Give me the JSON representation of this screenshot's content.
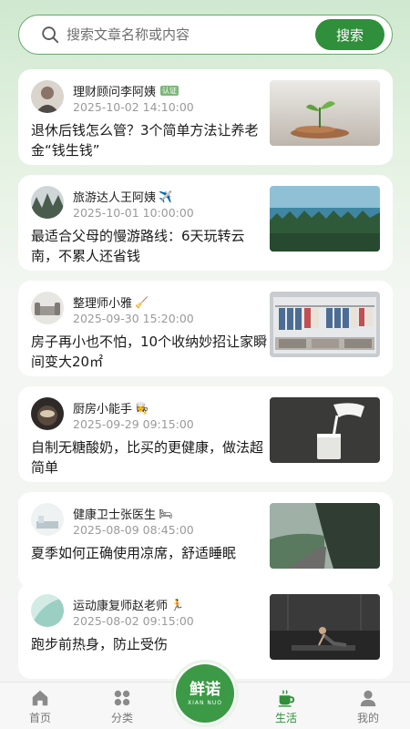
{
  "search": {
    "placeholder": "搜索文章名称或内容",
    "button_label": "搜索"
  },
  "articles": [
    {
      "author": "理财顾问李阿姨",
      "author_badge": "认证",
      "time": "2025-10-02 14:10:00",
      "title": "退休后钱怎么管？3个简单方法让养老金“钱生钱”"
    },
    {
      "author": "旅游达人王阿姨",
      "author_badge": "✈️",
      "time": "2025-10-01 10:00:00",
      "title": "最适合父母的慢游路线：6天玩转云南，不累人还省钱"
    },
    {
      "author": "整理师小雅",
      "author_badge": "🧹",
      "time": "2025-09-30 15:20:00",
      "title": "房子再小也不怕，10个收纳妙招让家瞬间变大20㎡"
    },
    {
      "author": "厨房小能手",
      "author_badge": "👩‍🍳",
      "time": "2025-09-29 09:15:00",
      "title": "自制无糖酸奶，比买的更健康，做法超简单"
    },
    {
      "author": "健康卫士张医生",
      "author_badge": "🛏",
      "time": "2025-08-09 08:45:00",
      "title": "夏季如何正确使用凉席，舒适睡眠"
    },
    {
      "author": "运动康复师赵老师",
      "author_badge": "🏃",
      "time": "2025-08-02 09:15:00",
      "title": "跑步前热身，防止受伤"
    }
  ],
  "nav": {
    "home": "首页",
    "category": "分类",
    "logo_cn": "鲜诺",
    "logo_en": "XIAN NUO",
    "life": "生活",
    "mine": "我的",
    "active_color": "#2f8f3a"
  }
}
